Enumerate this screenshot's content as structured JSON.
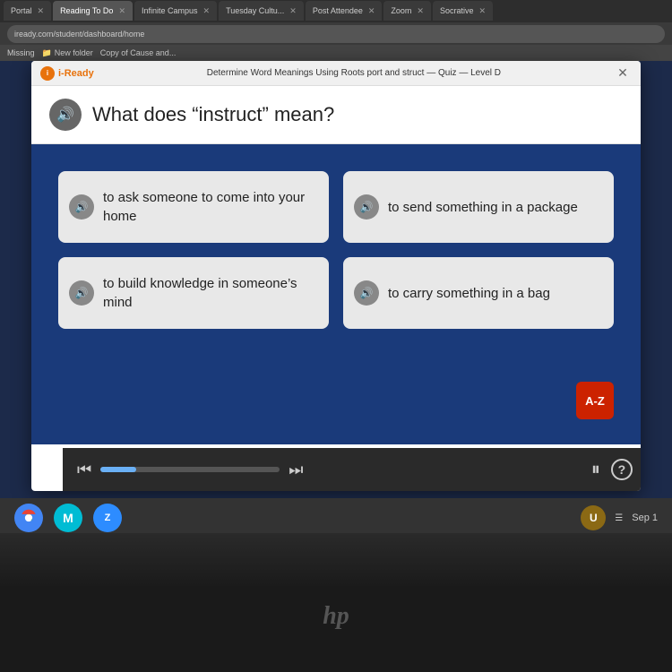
{
  "browser": {
    "tabs": [
      {
        "label": "Portal",
        "active": false
      },
      {
        "label": "Reading To Do",
        "active": false
      },
      {
        "label": "Infinite Campus",
        "active": false
      },
      {
        "label": "Tuesday Cultu...",
        "active": false
      },
      {
        "label": "Post Attendee",
        "active": false
      },
      {
        "label": "Zoom",
        "active": false
      },
      {
        "label": "Socrative",
        "active": false
      }
    ],
    "address": "iready.com/student/dashboard/home",
    "bookmarks": [
      "Missing",
      "New folder",
      "Copy of Cause and..."
    ]
  },
  "window": {
    "title": "Determine Word Meanings Using Roots port and struct — Quiz — Level D",
    "close_label": "✕",
    "logo_text": "i-Ready"
  },
  "question": {
    "text": "What does “instruct” mean?",
    "speaker_icon": "🔊"
  },
  "answers": [
    {
      "id": "a",
      "text": "to ask someone to come into your home"
    },
    {
      "id": "b",
      "text": "to send something in a package"
    },
    {
      "id": "c",
      "text": "to build knowledge in someone’s mind"
    },
    {
      "id": "d",
      "text": "to carry something in a bag"
    }
  ],
  "media_controls": {
    "skip_back": "⏮",
    "skip_forward": "⏭",
    "pause": "⏸",
    "help": "?",
    "gear": "⚙"
  },
  "az_button_label": "A-Z",
  "taskbar": {
    "icons": [
      "Chrome",
      "Meet",
      "Zoom"
    ],
    "time": "Sep 1",
    "user_initial": "U"
  }
}
